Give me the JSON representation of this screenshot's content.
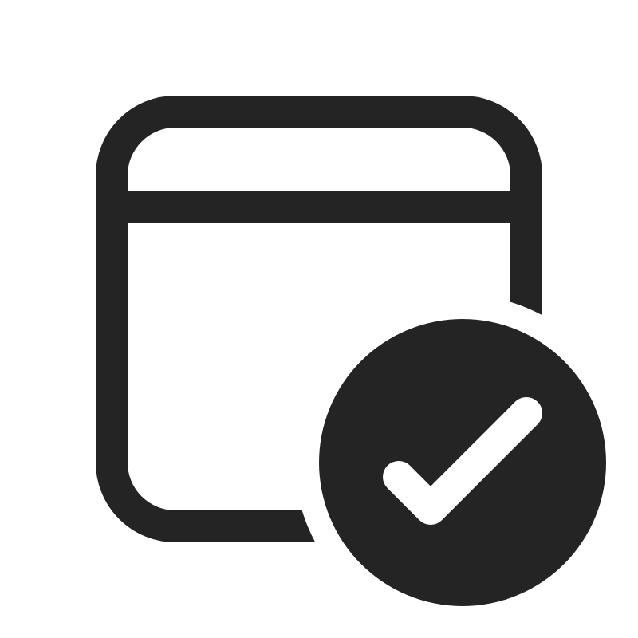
{
  "icon": {
    "name": "calendar-checkmark-icon",
    "colors": {
      "foreground": "#242424",
      "background": "#ffffff",
      "check": "#ffffff"
    }
  }
}
